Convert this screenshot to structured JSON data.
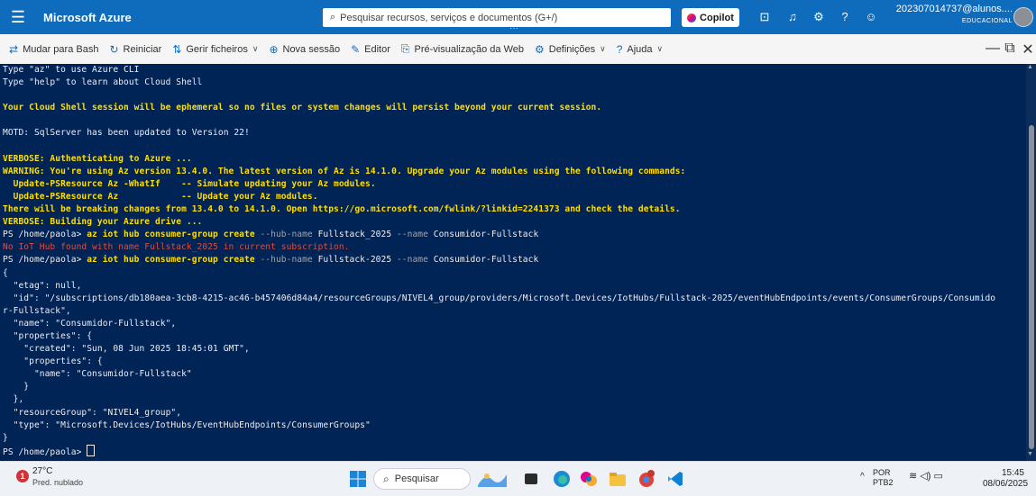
{
  "topbar": {
    "app_title": "Microsoft Azure",
    "search_placeholder": "Pesquisar recursos, serviços e documentos (G+/)",
    "copilot_label": "Copilot",
    "user_email": "202307014737@alunos....",
    "user_org": "EDUCACIONAL",
    "icons": [
      "cloud-shell-icon",
      "bell-icon",
      "gear-icon",
      "help-icon",
      "feedback-icon"
    ]
  },
  "toolbar": {
    "items": [
      {
        "icon": "⇄",
        "label": "Mudar para Bash",
        "dropdown": false
      },
      {
        "icon": "↻",
        "label": "Reiniciar",
        "dropdown": false
      },
      {
        "icon": "⇅",
        "label": "Gerir ficheiros",
        "dropdown": true
      },
      {
        "icon": "⊕",
        "label": "Nova sessão",
        "dropdown": false
      },
      {
        "icon": "✎",
        "label": "Editor",
        "dropdown": false
      },
      {
        "icon": "⎘",
        "label": "Pré-visualização da Web",
        "dropdown": false
      },
      {
        "icon": "⚙",
        "label": "Definições",
        "dropdown": true
      },
      {
        "icon": "?",
        "label": "Ajuda",
        "dropdown": true
      }
    ]
  },
  "terminal": {
    "lines": [
      [
        {
          "t": "Type \"az\" to use Azure CLI",
          "c": "white"
        }
      ],
      [
        {
          "t": "Type \"help\" to learn about Cloud Shell",
          "c": "white"
        }
      ],
      [
        {
          "t": "",
          "c": "white"
        }
      ],
      [
        {
          "t": "Your Cloud Shell session will be ephemeral so no files or system changes will persist beyond your current session.",
          "c": "yellow"
        }
      ],
      [
        {
          "t": "",
          "c": "white"
        }
      ],
      [
        {
          "t": "MOTD: SqlServer has been updated to Version 22!",
          "c": "white"
        }
      ],
      [
        {
          "t": "",
          "c": "white"
        }
      ],
      [
        {
          "t": "VERBOSE: Authenticating to Azure ...",
          "c": "yellow"
        }
      ],
      [
        {
          "t": "WARNING: You're using Az version 13.4.0. The latest version of Az is 14.1.0. Upgrade your Az modules using the following commands:",
          "c": "yellow"
        }
      ],
      [
        {
          "t": "  Update-PSResource Az -WhatIf    -- Simulate updating your Az modules.",
          "c": "yellow"
        }
      ],
      [
        {
          "t": "  Update-PSResource Az            -- Update your Az modules.",
          "c": "yellow"
        }
      ],
      [
        {
          "t": "There will be breaking changes from 13.4.0 to 14.1.0. Open https://go.microsoft.com/fwlink/?linkid=2241373 and check the details.",
          "c": "yellow"
        }
      ],
      [
        {
          "t": "VERBOSE: Building your Azure drive ...",
          "c": "yellow"
        }
      ],
      [
        {
          "t": "PS /home/paola> ",
          "c": "white"
        },
        {
          "t": "az iot hub consumer-group create ",
          "c": "yellow"
        },
        {
          "t": "--hub-name ",
          "c": "p-gray"
        },
        {
          "t": "Fullstack_2025 ",
          "c": "white"
        },
        {
          "t": "--name ",
          "c": "p-gray"
        },
        {
          "t": "Consumidor-Fullstack",
          "c": "white"
        }
      ],
      [
        {
          "t": "No IoT Hub found with name Fullstack_2025 in current subscription.",
          "c": "red"
        }
      ],
      [
        {
          "t": "PS /home/paola> ",
          "c": "white"
        },
        {
          "t": "az iot hub consumer-group create ",
          "c": "yellow"
        },
        {
          "t": "--hub-name ",
          "c": "p-gray"
        },
        {
          "t": "Fullstack-2025 ",
          "c": "white"
        },
        {
          "t": "--name ",
          "c": "p-gray"
        },
        {
          "t": "Consumidor-Fullstack",
          "c": "white"
        }
      ],
      [
        {
          "t": "{",
          "c": "white"
        }
      ],
      [
        {
          "t": "  \"etag\": null,",
          "c": "white"
        }
      ],
      [
        {
          "t": "  \"id\": \"/subscriptions/db180aea-3cb8-4215-ac46-b457406d84a4/resourceGroups/NIVEL4_group/providers/Microsoft.Devices/IotHubs/Fullstack-2025/eventHubEndpoints/events/ConsumerGroups/Consumido",
          "c": "white"
        }
      ],
      [
        {
          "t": "r-Fullstack\",",
          "c": "white"
        }
      ],
      [
        {
          "t": "  \"name\": \"Consumidor-Fullstack\",",
          "c": "white"
        }
      ],
      [
        {
          "t": "  \"properties\": {",
          "c": "white"
        }
      ],
      [
        {
          "t": "    \"created\": \"Sun, 08 Jun 2025 18:45:01 GMT\",",
          "c": "white"
        }
      ],
      [
        {
          "t": "    \"properties\": {",
          "c": "white"
        }
      ],
      [
        {
          "t": "      \"name\": \"Consumidor-Fullstack\"",
          "c": "white"
        }
      ],
      [
        {
          "t": "    }",
          "c": "white"
        }
      ],
      [
        {
          "t": "  },",
          "c": "white"
        }
      ],
      [
        {
          "t": "  \"resourceGroup\": \"NIVEL4_group\",",
          "c": "white"
        }
      ],
      [
        {
          "t": "  \"type\": \"Microsoft.Devices/IotHubs/EventHubEndpoints/ConsumerGroups\"",
          "c": "white"
        }
      ],
      [
        {
          "t": "}",
          "c": "white"
        }
      ],
      [
        {
          "t": "PS /home/paola> ",
          "c": "white"
        }
      ]
    ]
  },
  "taskbar": {
    "weather_temp": "27°C",
    "weather_desc": "Pred. nublado",
    "weather_badge": "1",
    "search_label": "Pesquisar",
    "lang_top": "POR",
    "lang_bottom": "PTB2",
    "time": "15:45",
    "date": "08/06/2025"
  },
  "colors": {
    "azure_blue": "#0f6cbd",
    "terminal_bg": "#012456",
    "terminal_yellow": "#ffde00",
    "terminal_red": "#e24a3c"
  }
}
